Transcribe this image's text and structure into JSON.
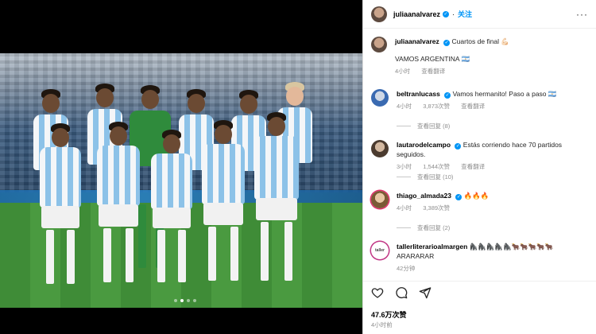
{
  "post": {
    "author": "juliaanalvarez",
    "follow_label": "关注",
    "dot": "·",
    "more": "···",
    "caption": {
      "author": "juliaanalvarez",
      "text": "Cuartos de final 💪🏻",
      "body": "VAMOS ARGENTINA 🇦🇷",
      "time": "4小时",
      "translate": "查看翻译"
    }
  },
  "comments": [
    {
      "user": "beltranlucass",
      "text": "Vamos hermanito! Paso a paso 🇦🇷",
      "time": "4小时",
      "likes": "3,873次赞",
      "translate": "查看翻译",
      "replies": "查看回复 (8)"
    },
    {
      "user": "lautarodelcampo",
      "text": "Estás corriendo hace 70 partidos seguidos.",
      "time": "3小时",
      "likes": "1,544次赞",
      "translate": "查看翻译",
      "replies": "查看回复 (10)"
    },
    {
      "user": "thiago_almada23",
      "text": "🔥🔥🔥",
      "time": "4小时",
      "likes": "3,389次赞",
      "replies": "查看回复 (2)"
    },
    {
      "user": "tallerliterarioalmargen",
      "text": "🦍🦍🦍🦍🦍🐂🐂🐂🐂🐂 ARARARAR",
      "time": "42分钟",
      "avatar_text": "taller"
    }
  ],
  "footer": {
    "likes": "47.6万次赞",
    "time": "4小时前"
  },
  "icons": {
    "like": "heart-icon",
    "comment": "comment-icon",
    "share": "share-icon"
  },
  "carousel": {
    "count": 4,
    "active": 2
  }
}
